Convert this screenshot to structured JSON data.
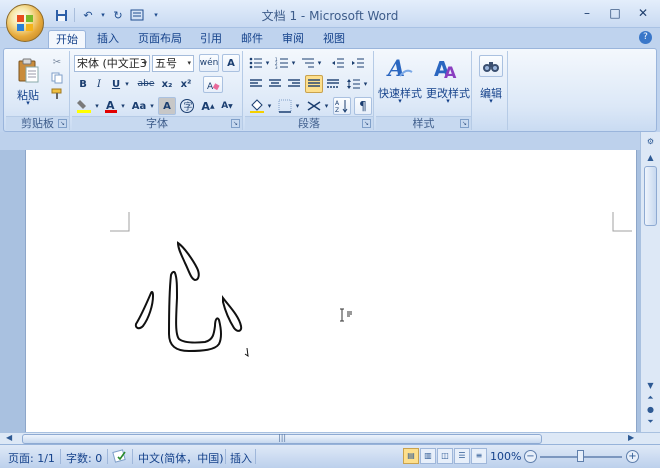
{
  "window": {
    "title": "文档 1 - Microsoft Word",
    "minimize": "–",
    "maximize": "□",
    "close": "✕"
  },
  "tabs": [
    {
      "label": "开始",
      "active": true
    },
    {
      "label": "插入"
    },
    {
      "label": "页面布局"
    },
    {
      "label": "引用"
    },
    {
      "label": "邮件"
    },
    {
      "label": "审阅"
    },
    {
      "label": "视图"
    }
  ],
  "clipboard": {
    "paste_label": "粘贴",
    "group_label": "剪贴板"
  },
  "font": {
    "font_name": "宋体 (中文正3",
    "font_size": "五号",
    "bold": "B",
    "italic": "I",
    "underline": "U",
    "strike": "abe",
    "subscript": "x₂",
    "superscript": "x²",
    "font_color": "A",
    "change_case": "Aa",
    "char_shading": "A",
    "enclose": "㊟",
    "grow": "A",
    "shrink": "A",
    "group_label": "字体"
  },
  "paragraph": {
    "group_label": "段落"
  },
  "styles": {
    "quick_styles": "快速样式",
    "change_styles": "更改样式",
    "group_label": "样式"
  },
  "editing": {
    "label": "编辑"
  },
  "status": {
    "page": "页面: 1/1",
    "words": "字数: 0",
    "language": "中文(简体，中国)",
    "mode": "插入",
    "zoom": "100%"
  },
  "colors": {
    "highlight": "#ffff00",
    "font_color": "#e30000",
    "ribbon_bg": "#dce8f7",
    "frame": "#bfd3ee"
  }
}
